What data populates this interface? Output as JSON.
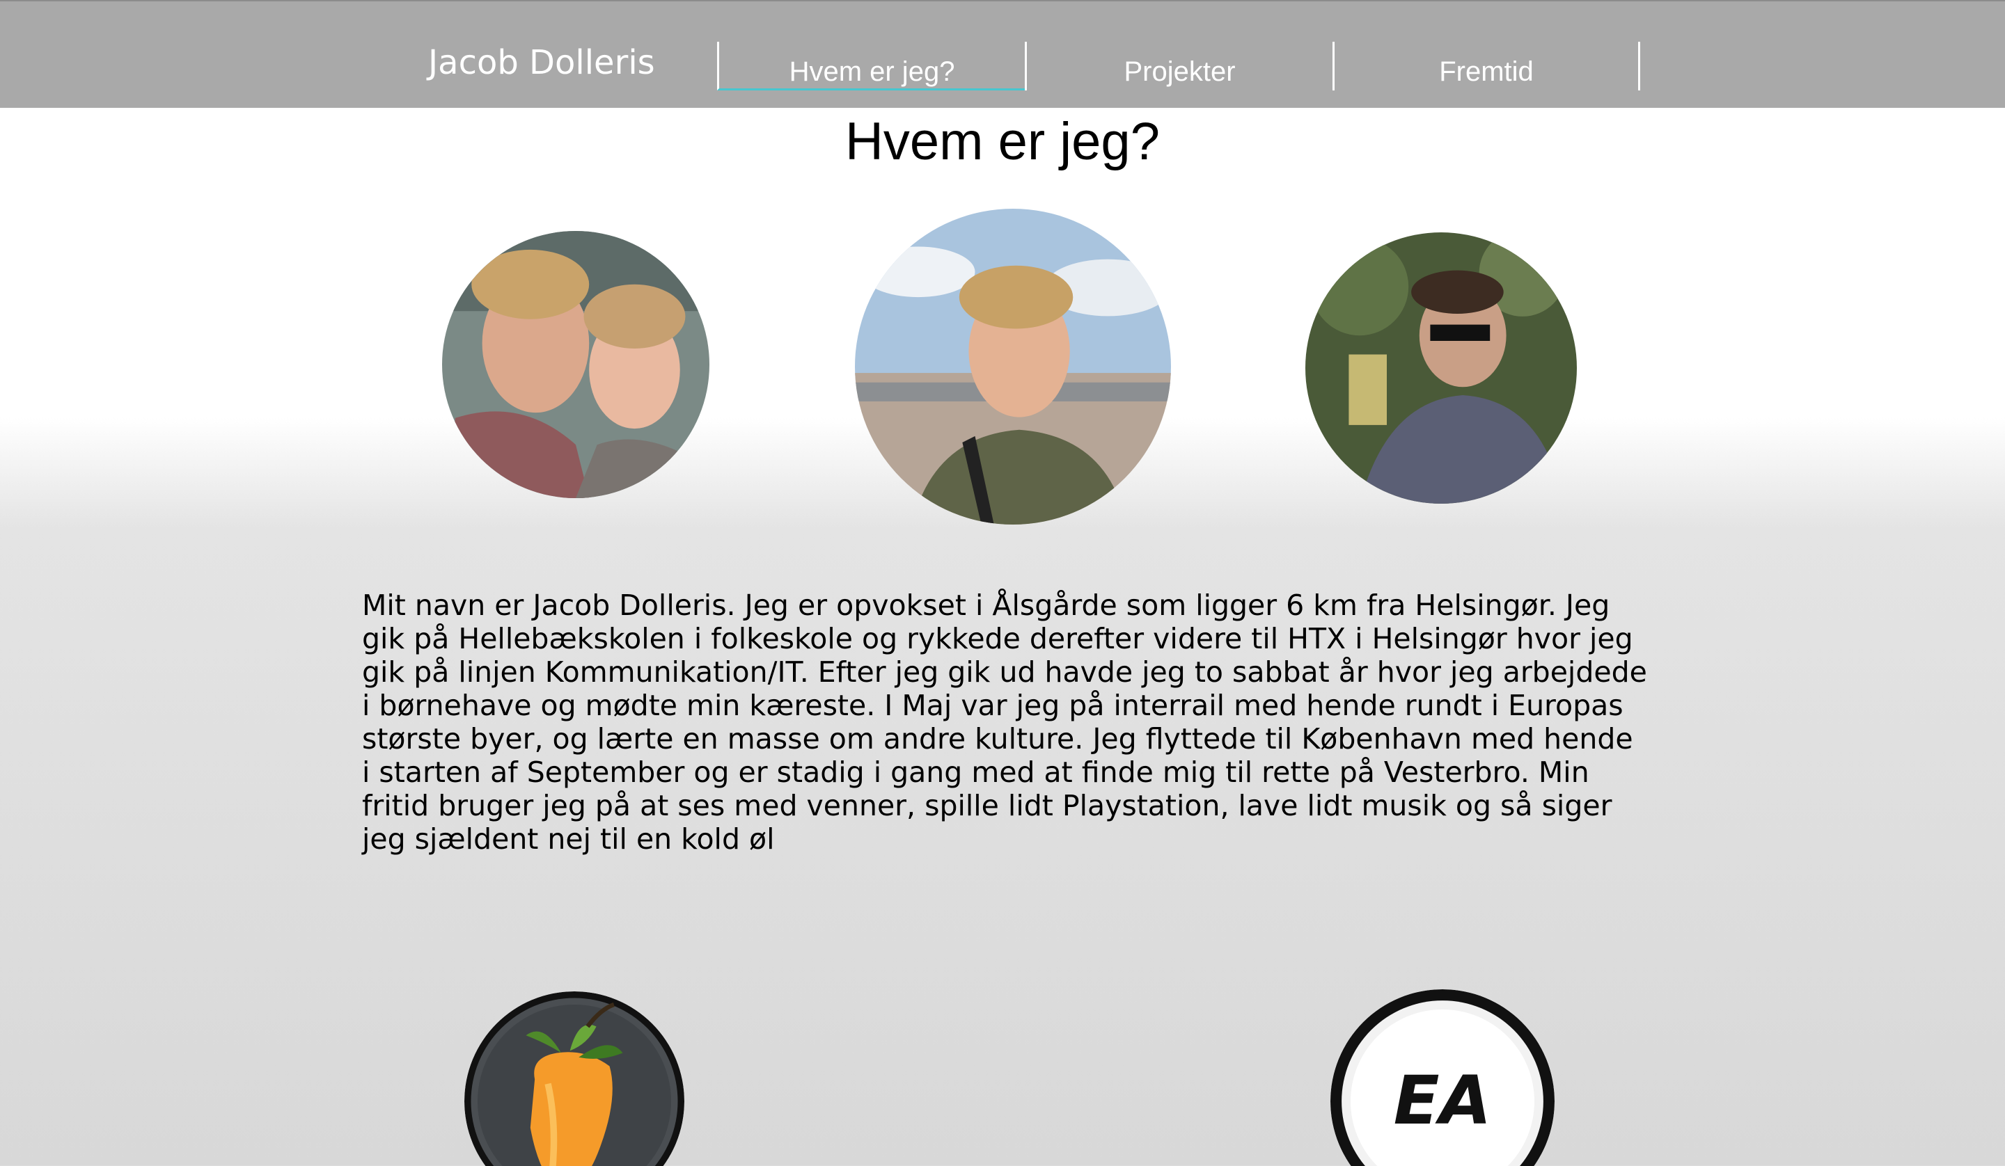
{
  "nav": {
    "brand": "Jacob Dolleris",
    "items": [
      {
        "label": "Hvem er jeg?",
        "active": true
      },
      {
        "label": "Projekter",
        "active": false
      },
      {
        "label": "Fremtid",
        "active": false
      }
    ]
  },
  "main": {
    "title": "Hvem er jeg?",
    "bio": "Mit navn er Jacob Dolleris. Jeg er opvokset i Ålsgårde som ligger 6 km fra Helsingør. Jeg gik på Hellebækskolen i folkeskole og rykkede derefter videre til HTX i Helsingør hvor jeg gik på linjen Kommunikation/IT. Efter jeg gik ud havde jeg to sabbat år hvor jeg arbejdede i børnehave og mødte min kæreste. I Maj var jeg på interrail med hende rundt i Europas største byer, og lærte en masse om andre kulture. Jeg flyttede til København med hende i starten af September og er stadig i gang med at finde mig til rette på Vesterbro. Min fritid bruger jeg på at ses med venner, spille lidt Playstation, lave lidt musik og så siger jeg sjældent nej til en kold øl"
  },
  "logos": {
    "ea_text": "EA"
  },
  "colors": {
    "navbar": "#a9a9a9",
    "active_underline": "#47c6cf"
  }
}
